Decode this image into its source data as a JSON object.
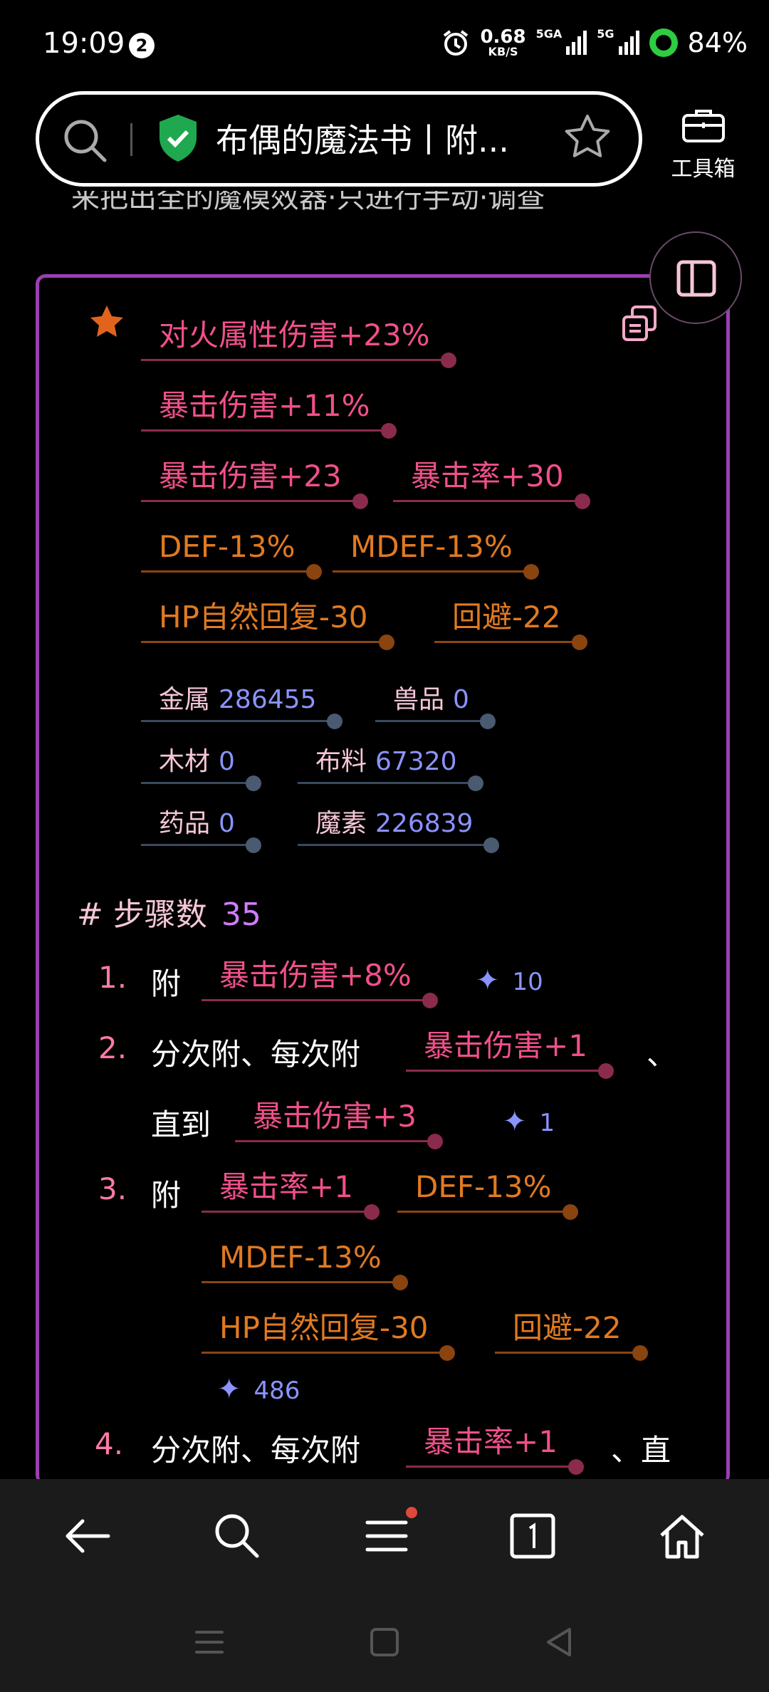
{
  "status_bar": {
    "time": "19:09",
    "notification_count": "2",
    "net_speed": "0.68",
    "net_speed_unit": "KB/S",
    "net_type_1": "5GA",
    "net_type_2": "5G",
    "battery": "84%"
  },
  "browser": {
    "page_title": "布偶的魔法书丨附...",
    "toolbox_label": "工具箱"
  },
  "content": {
    "partial_text": "来把出全的魔模效器·只进行手动·调查",
    "result_tags": [
      [
        "对火属性伤害+23%"
      ],
      [
        "暴击伤害+11%"
      ],
      [
        "暴击伤害+23",
        "暴击率+30"
      ],
      [
        "DEF-13%",
        "MDEF-13%"
      ],
      [
        "HP自然回复-30",
        "回避-22"
      ]
    ],
    "resources": [
      {
        "label": "金属",
        "value": "286455"
      },
      {
        "label": "兽品",
        "value": "0"
      },
      {
        "label": "木材",
        "value": "0"
      },
      {
        "label": "布料",
        "value": "67320"
      },
      {
        "label": "药品",
        "value": "0"
      },
      {
        "label": "魔素",
        "value": "226839"
      }
    ],
    "steps_header": "# 步骤数",
    "steps_count": "35",
    "steps": [
      {
        "num": "1.",
        "text_a": "附",
        "tag_a": "暴击伤害+8%",
        "spark": "10"
      },
      {
        "num": "2.",
        "text_a": "分次附、每次附",
        "tag_a": "暴击伤害+1",
        "text_b": "、",
        "text_c": "直到",
        "tag_b": "暴击伤害+3",
        "spark": "1"
      },
      {
        "num": "3.",
        "text_a": "附",
        "tag_a": "暴击率+1",
        "tag_b": "DEF-13%",
        "tag_c": "MDEF-13%",
        "tag_d": "HP自然回复-30",
        "tag_e": "回避-22",
        "spark": "486"
      },
      {
        "num": "4.",
        "text_a": "分次附、每次附",
        "tag_a": "暴击率+1",
        "text_b": "、直"
      }
    ]
  }
}
